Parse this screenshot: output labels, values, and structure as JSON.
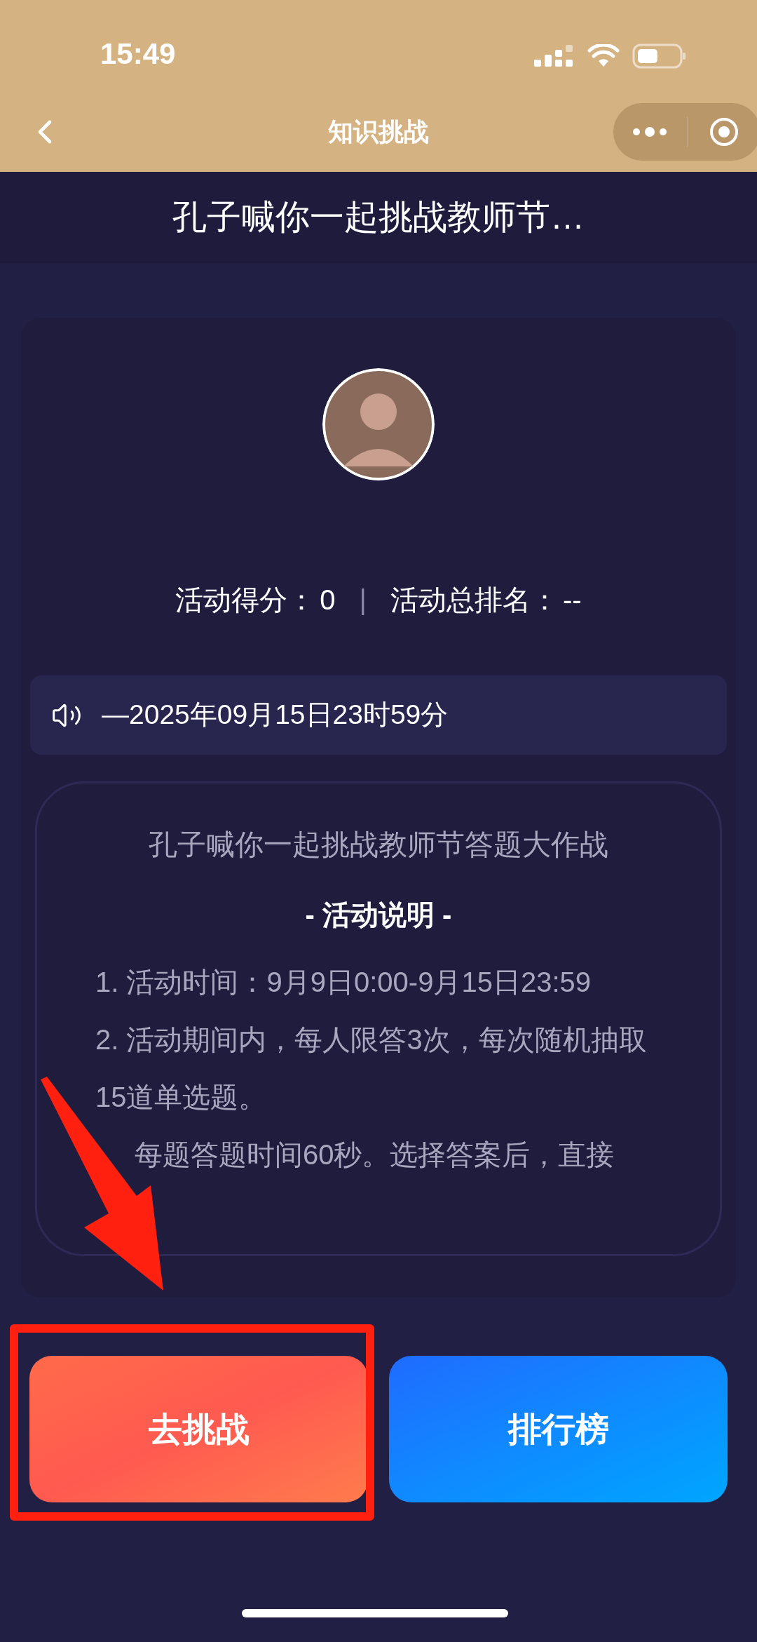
{
  "status_bar": {
    "time": "15:49"
  },
  "nav_bar": {
    "title": "知识挑战"
  },
  "header": {
    "title": "孔子喊你一起挑战教师节…"
  },
  "profile": {
    "score_label": "活动得分：",
    "score": "0",
    "separator": "|",
    "rank_label": "活动总排名：",
    "rank": "--"
  },
  "notice": {
    "text": "—2025年09月15日23时59分"
  },
  "rules": {
    "title": "孔子喊你一起挑战教师节答题大作战",
    "heading": "- 活动说明 -",
    "items": [
      {
        "number": "1.",
        "text": "活动时间：9月9日0:00-9月15日23:59"
      },
      {
        "number": "2.",
        "text": "活动期间内，每人限答3次，每次随机抽取15道单选题。"
      },
      {
        "text": "每题答题时间60秒。选择答案后，直接"
      }
    ]
  },
  "buttons": [
    {
      "label": "去挑战",
      "kind": "challenge",
      "highlighted": true
    },
    {
      "label": "排行榜",
      "kind": "ranking",
      "highlighted": false
    }
  ]
}
